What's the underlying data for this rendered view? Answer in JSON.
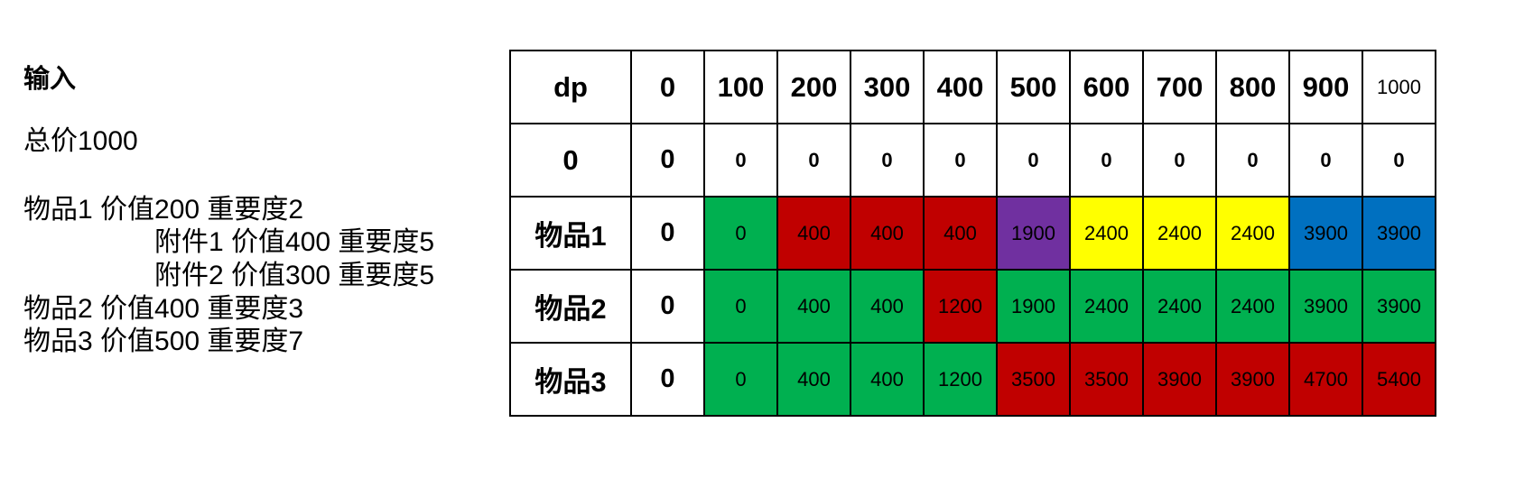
{
  "left": {
    "heading": "输入",
    "total": "总价1000",
    "lines": [
      {
        "text": "物品1 价值200 重要度2",
        "indent": false
      },
      {
        "text": "附件1 价值400 重要度5",
        "indent": true
      },
      {
        "text": "附件2 价值300 重要度5",
        "indent": true
      },
      {
        "text": "物品2 价值400 重要度3",
        "indent": false
      },
      {
        "text": "物品3 价值500 重要度7",
        "indent": false
      }
    ]
  },
  "colors": {
    "green": "#00b050",
    "red": "#c00000",
    "purple": "#7030a0",
    "yellow": "#ffff00",
    "blue": "#0070c0",
    "white": "#ffffff"
  },
  "table": {
    "corner": "dp",
    "columns": [
      "0",
      "100",
      "200",
      "300",
      "400",
      "500",
      "600",
      "700",
      "800",
      "900",
      "1000"
    ],
    "rows": [
      {
        "label": "0",
        "first": "0",
        "cells": [
          {
            "v": "0",
            "c": "white"
          },
          {
            "v": "0",
            "c": "white"
          },
          {
            "v": "0",
            "c": "white"
          },
          {
            "v": "0",
            "c": "white"
          },
          {
            "v": "0",
            "c": "white"
          },
          {
            "v": "0",
            "c": "white"
          },
          {
            "v": "0",
            "c": "white"
          },
          {
            "v": "0",
            "c": "white"
          },
          {
            "v": "0",
            "c": "white"
          },
          {
            "v": "0",
            "c": "white"
          }
        ]
      },
      {
        "label": "物品1",
        "first": "0",
        "cells": [
          {
            "v": "0",
            "c": "green"
          },
          {
            "v": "400",
            "c": "red"
          },
          {
            "v": "400",
            "c": "red"
          },
          {
            "v": "400",
            "c": "red"
          },
          {
            "v": "1900",
            "c": "purple"
          },
          {
            "v": "2400",
            "c": "yellow"
          },
          {
            "v": "2400",
            "c": "yellow"
          },
          {
            "v": "2400",
            "c": "yellow"
          },
          {
            "v": "3900",
            "c": "blue"
          },
          {
            "v": "3900",
            "c": "blue"
          }
        ]
      },
      {
        "label": "物品2",
        "first": "0",
        "cells": [
          {
            "v": "0",
            "c": "green"
          },
          {
            "v": "400",
            "c": "green"
          },
          {
            "v": "400",
            "c": "green"
          },
          {
            "v": "1200",
            "c": "red"
          },
          {
            "v": "1900",
            "c": "green"
          },
          {
            "v": "2400",
            "c": "green"
          },
          {
            "v": "2400",
            "c": "green"
          },
          {
            "v": "2400",
            "c": "green"
          },
          {
            "v": "3900",
            "c": "green"
          },
          {
            "v": "3900",
            "c": "green"
          }
        ]
      },
      {
        "label": "物品3",
        "first": "0",
        "cells": [
          {
            "v": "0",
            "c": "green"
          },
          {
            "v": "400",
            "c": "green"
          },
          {
            "v": "400",
            "c": "green"
          },
          {
            "v": "1200",
            "c": "green"
          },
          {
            "v": "3500",
            "c": "red"
          },
          {
            "v": "3500",
            "c": "red"
          },
          {
            "v": "3900",
            "c": "red"
          },
          {
            "v": "3900",
            "c": "red"
          },
          {
            "v": "4700",
            "c": "red"
          },
          {
            "v": "5400",
            "c": "red"
          }
        ]
      }
    ]
  }
}
